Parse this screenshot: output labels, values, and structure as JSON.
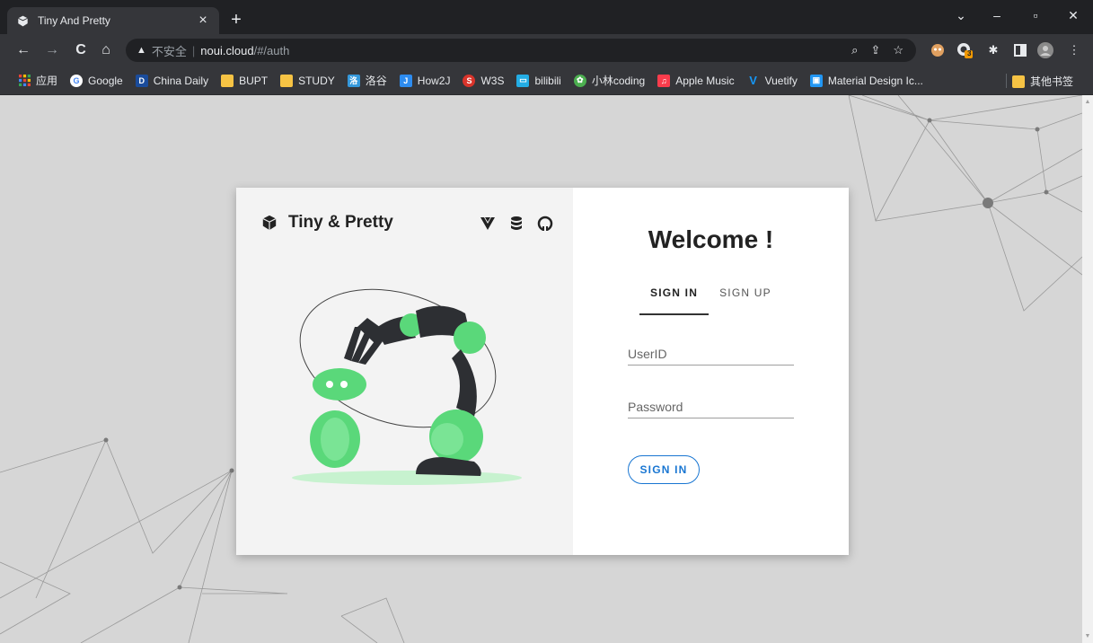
{
  "browser": {
    "tab": {
      "title": "Tiny And Pretty",
      "close": "×"
    },
    "new_tab": "+",
    "window_controls": {
      "minimize": "–",
      "restore": "▫",
      "close": "✕",
      "tabsearch": "⌄"
    },
    "nav": {
      "back": "←",
      "forward": "→",
      "reload": "C",
      "home": "⌂"
    },
    "omnibox": {
      "security_icon": "warning-triangle-icon",
      "security_label": "不安全",
      "host": "noui.cloud",
      "path": "/#/auth"
    },
    "extension_badge": "3"
  },
  "bookmarks": {
    "items": [
      {
        "label": "应用",
        "icon": "apps-grid-icon",
        "color": "#ea4335"
      },
      {
        "label": "Google",
        "icon": "google-icon",
        "color": "#4285f4"
      },
      {
        "label": "China Daily",
        "icon": "chinadaily-icon",
        "color": "#1a4c9c"
      },
      {
        "label": "BUPT",
        "icon": "folder-icon",
        "color": "#f6c344"
      },
      {
        "label": "STUDY",
        "icon": "folder-icon",
        "color": "#f6c344"
      },
      {
        "label": "洛谷",
        "icon": "luogu-icon",
        "color": "#3498db"
      },
      {
        "label": "How2J",
        "icon": "how2j-icon",
        "color": "#2d8cf0"
      },
      {
        "label": "W3S",
        "icon": "w3s-icon",
        "color": "#d9342b"
      },
      {
        "label": "bilibili",
        "icon": "bilibili-icon",
        "color": "#23ade5"
      },
      {
        "label": "小林coding",
        "icon": "xiaolin-icon",
        "color": "#4caf50"
      },
      {
        "label": "Apple Music",
        "icon": "apple-music-icon",
        "color": "#fa3c4c"
      },
      {
        "label": "Vuetify",
        "icon": "vuetify-icon",
        "color": "#1697f6"
      },
      {
        "label": "Material Design Ic...",
        "icon": "material-design-icon",
        "color": "#2196f3"
      }
    ],
    "other": {
      "label": "其他书签",
      "icon": "folder-icon",
      "color": "#f6c344"
    }
  },
  "card": {
    "brand_name": "Tiny & Pretty",
    "brand_links": [
      "vuetify-icon",
      "database-icon",
      "github-icon"
    ],
    "welcome": "Welcome !",
    "tabs": {
      "signin": "SIGN IN",
      "signup": "SIGN UP",
      "active": "signin"
    },
    "userid_placeholder": "UserID",
    "password_placeholder": "Password",
    "signin_button": "SIGN IN",
    "accent_color": "#1976d2",
    "illustration_color": "#4cd964"
  }
}
